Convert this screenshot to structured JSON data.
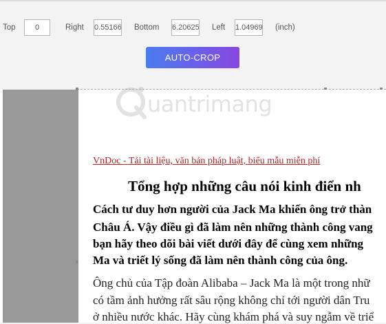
{
  "controls": {
    "top_label": "Top",
    "top_value": "0",
    "right_label": "Right",
    "right_value": "0.55166",
    "bottom_label": "Bottom",
    "bottom_value": "6.20625",
    "left_label": "Left",
    "left_value": "1.04969",
    "unit_label": "(inch)"
  },
  "autocrop_button": "AUTO-CROP",
  "watermark": "uantrimang",
  "document": {
    "link_prefix": "VnDoc - ",
    "link_text": "Tải tài liệu, văn bản pháp luật, biểu mẫu miễn phí",
    "title": "Tổng hợp những câu nói kinh điển nh",
    "bold_lines": [
      "Cách tư duy hơn người của Jack Ma khiến ông trở thàn",
      "Châu Á. Vậy điều gì đã làm nên những thành công vang",
      "bạn hãy theo dõi bài viết dưới đây để cùng xem những ",
      "Ma và triết lý sống đã làm nên thành công của ông."
    ],
    "body_lines": [
      "Ông chủ của Tập đoàn Alibaba – Jack Ma là một trong nhữ",
      "có tầm ảnh hưởng rất sâu rộng không chỉ tới người dân Tru",
      "ở nhiều nước khác. Hãy cùng khám phá và suy ngẫm về triể"
    ]
  }
}
